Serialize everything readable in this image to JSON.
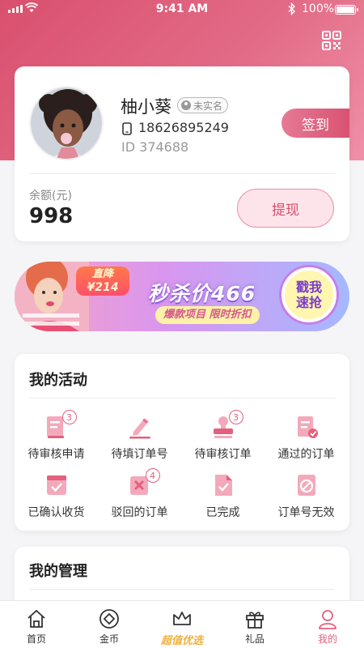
{
  "status_bar": {
    "time": "9:41 AM",
    "battery": "100%"
  },
  "profile": {
    "name": "柚小葵",
    "verify_status": "未实名",
    "phone": "18626895249",
    "id_label": "ID",
    "id_value": "374688",
    "sign_in_label": "签到",
    "balance_label": "余额(元)",
    "balance_value": "998",
    "withdraw_label": "提现"
  },
  "promo": {
    "price_tag_line1": "直降",
    "price_tag_line2": "¥214",
    "title": "秒杀价466",
    "subtitle": "爆款项目 限时折扣",
    "button_line1": "戳我",
    "button_line2": "速抢"
  },
  "activities": {
    "title": "我的活动",
    "items": [
      {
        "label": "待审核申请",
        "icon": "apply-doc-icon",
        "badge": "3"
      },
      {
        "label": "待填订单号",
        "icon": "pen-icon",
        "badge": ""
      },
      {
        "label": "待审核订单",
        "icon": "stamp-icon",
        "badge": "3"
      },
      {
        "label": "通过的订单",
        "icon": "approved-doc-icon",
        "badge": ""
      },
      {
        "label": "已确认收货",
        "icon": "received-box-icon",
        "badge": ""
      },
      {
        "label": "驳回的订单",
        "icon": "rejected-icon",
        "badge": "4"
      },
      {
        "label": "已完成",
        "icon": "completed-doc-icon",
        "badge": ""
      },
      {
        "label": "订单号无效",
        "icon": "invalid-icon",
        "badge": ""
      }
    ]
  },
  "management": {
    "title": "我的管理"
  },
  "tabs": [
    {
      "label": "首页",
      "icon": "home-icon"
    },
    {
      "label": "金币",
      "icon": "coin-icon"
    },
    {
      "label": "超值优选",
      "icon": "crown-icon"
    },
    {
      "label": "礼品",
      "icon": "gift-icon"
    },
    {
      "label": "我的",
      "icon": "user-icon"
    }
  ],
  "colors": {
    "brand": "#e3607f",
    "hero_start": "#d9506e",
    "hero_end": "#f090a8",
    "featured": "#f0b03c"
  }
}
